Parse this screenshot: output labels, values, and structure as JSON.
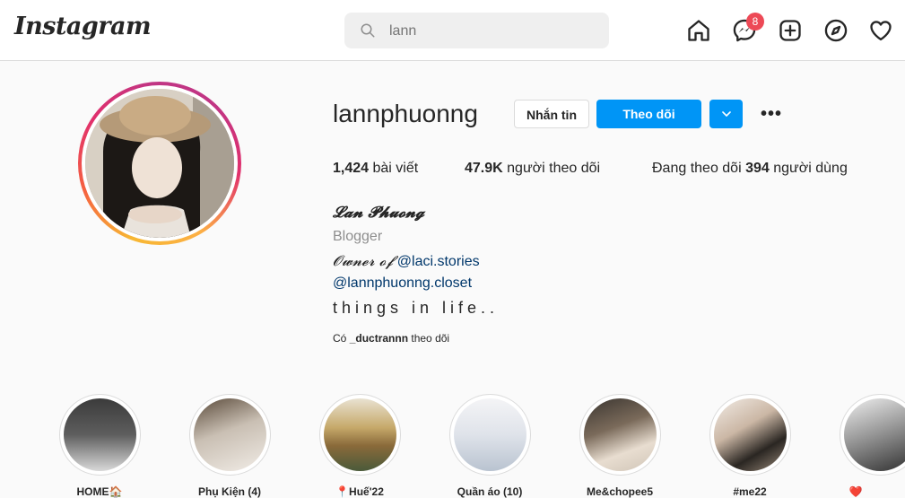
{
  "topbar": {
    "logo": "Instagram",
    "search_placeholder": "lann",
    "messenger_badge": "8"
  },
  "profile": {
    "username": "lannphuonng",
    "message_button": "Nhắn tin",
    "follow_button": "Theo dõi",
    "posts_count": "1,424",
    "posts_label": "bài viết",
    "followers_count": "47.9K",
    "followers_label": "người theo dõi",
    "following_prefix": "Đang theo dõi",
    "following_count": "394",
    "following_suffix": "người dùng",
    "full_name": "𝓛𝓪𝓷 𝓟𝓱𝓾𝓸𝓷𝓰",
    "category": "Blogger",
    "bio_owner_prefix": "𝓞𝔀𝓷𝓮𝓻 𝓸𝓯",
    "bio_owner_link": "@laci.stories",
    "bio_closet_link": "@lannphuonng.closet",
    "bio_things": "things in life..",
    "followed_by_prefix": "Có",
    "followed_by_user": "_ductrannn",
    "followed_by_suffix": "theo dõi"
  },
  "stories": [
    {
      "label": "HOME🏠"
    },
    {
      "label": "Phụ Kiện (4)"
    },
    {
      "label": "📍Huế'22"
    },
    {
      "label": "Quần áo (10)"
    },
    {
      "label": "Me&chopee5"
    },
    {
      "label": "#me22"
    },
    {
      "label": "❤️"
    }
  ],
  "colors": {
    "accent_blue": "#0095f6",
    "badge_red": "#ed4956",
    "link_blue": "#00376b"
  }
}
